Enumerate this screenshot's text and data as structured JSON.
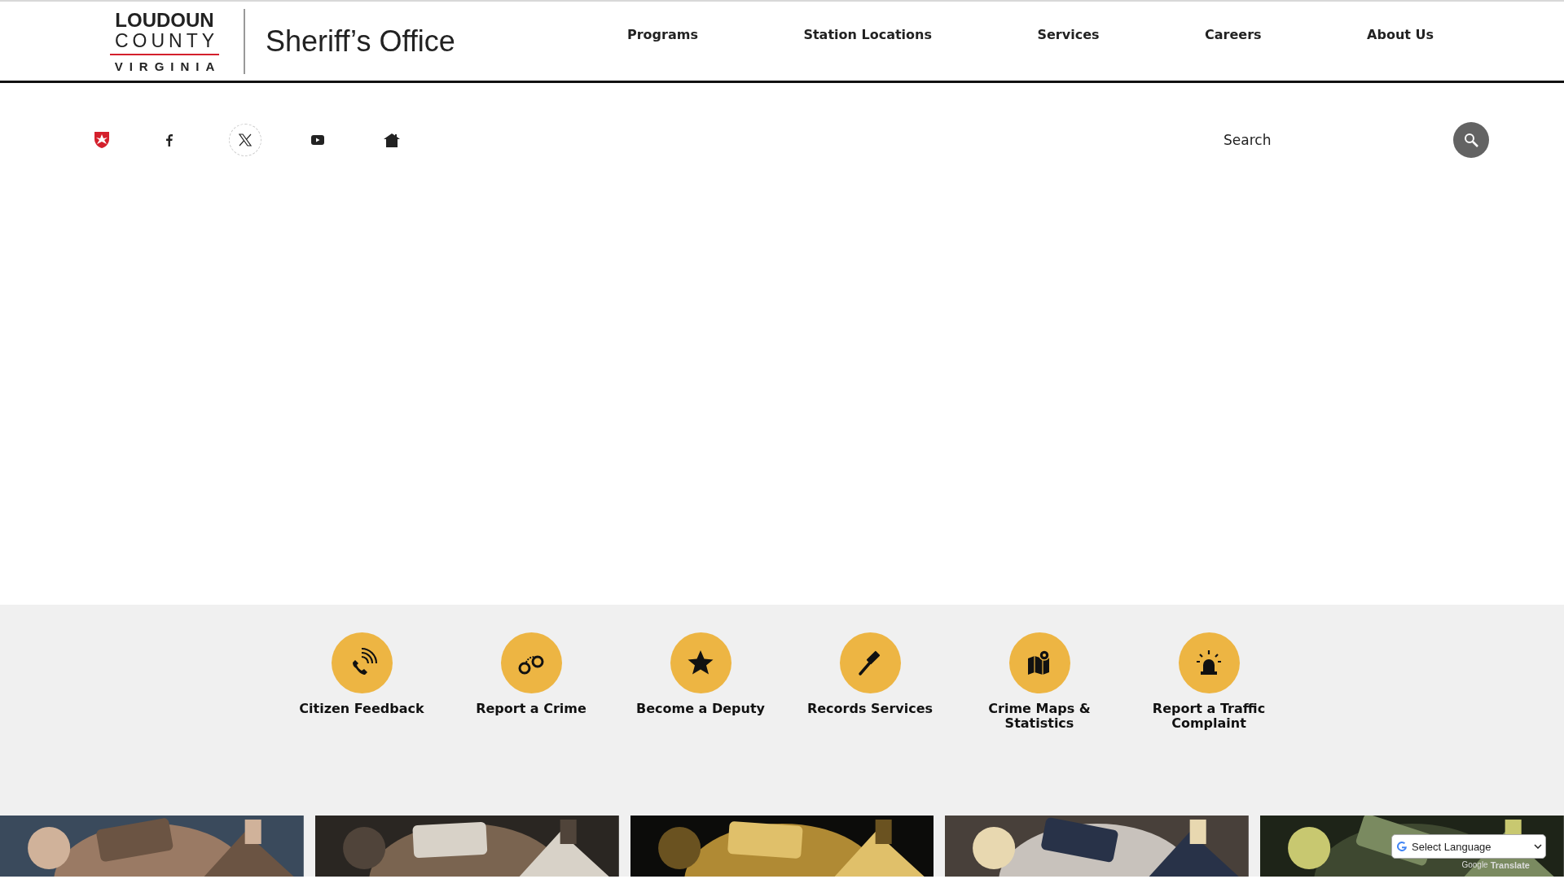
{
  "logo": {
    "line1": "LOUDOUN",
    "line2": "COUNTY",
    "line3": "VIRGINIA",
    "office": "Sheriff’s Office"
  },
  "nav": [
    "Programs",
    "Station Locations",
    "Services",
    "Careers",
    "About Us"
  ],
  "social": [
    {
      "kind": "shield"
    },
    {
      "kind": "facebook"
    },
    {
      "kind": "x"
    },
    {
      "kind": "youtube"
    },
    {
      "kind": "home"
    }
  ],
  "search": {
    "placeholder": "Search"
  },
  "quick_links": [
    {
      "kind": "phone",
      "label": "Citizen Feedback"
    },
    {
      "kind": "handcuffs",
      "label": "Report a Crime"
    },
    {
      "kind": "star",
      "label": "Become a Deputy"
    },
    {
      "kind": "gavel",
      "label": "Records Services"
    },
    {
      "kind": "map",
      "label": "Crime Maps & Statistics"
    },
    {
      "kind": "siren",
      "label": "Report a Traffic Complaint"
    }
  ],
  "pictures": [
    {
      "kind": "picture"
    },
    {
      "kind": "picture"
    },
    {
      "kind": "picture"
    },
    {
      "kind": "picture"
    },
    {
      "kind": "picture"
    }
  ],
  "translate": {
    "select": "Select Language",
    "powered_brand": "Google",
    "powered_word": "Translate"
  }
}
